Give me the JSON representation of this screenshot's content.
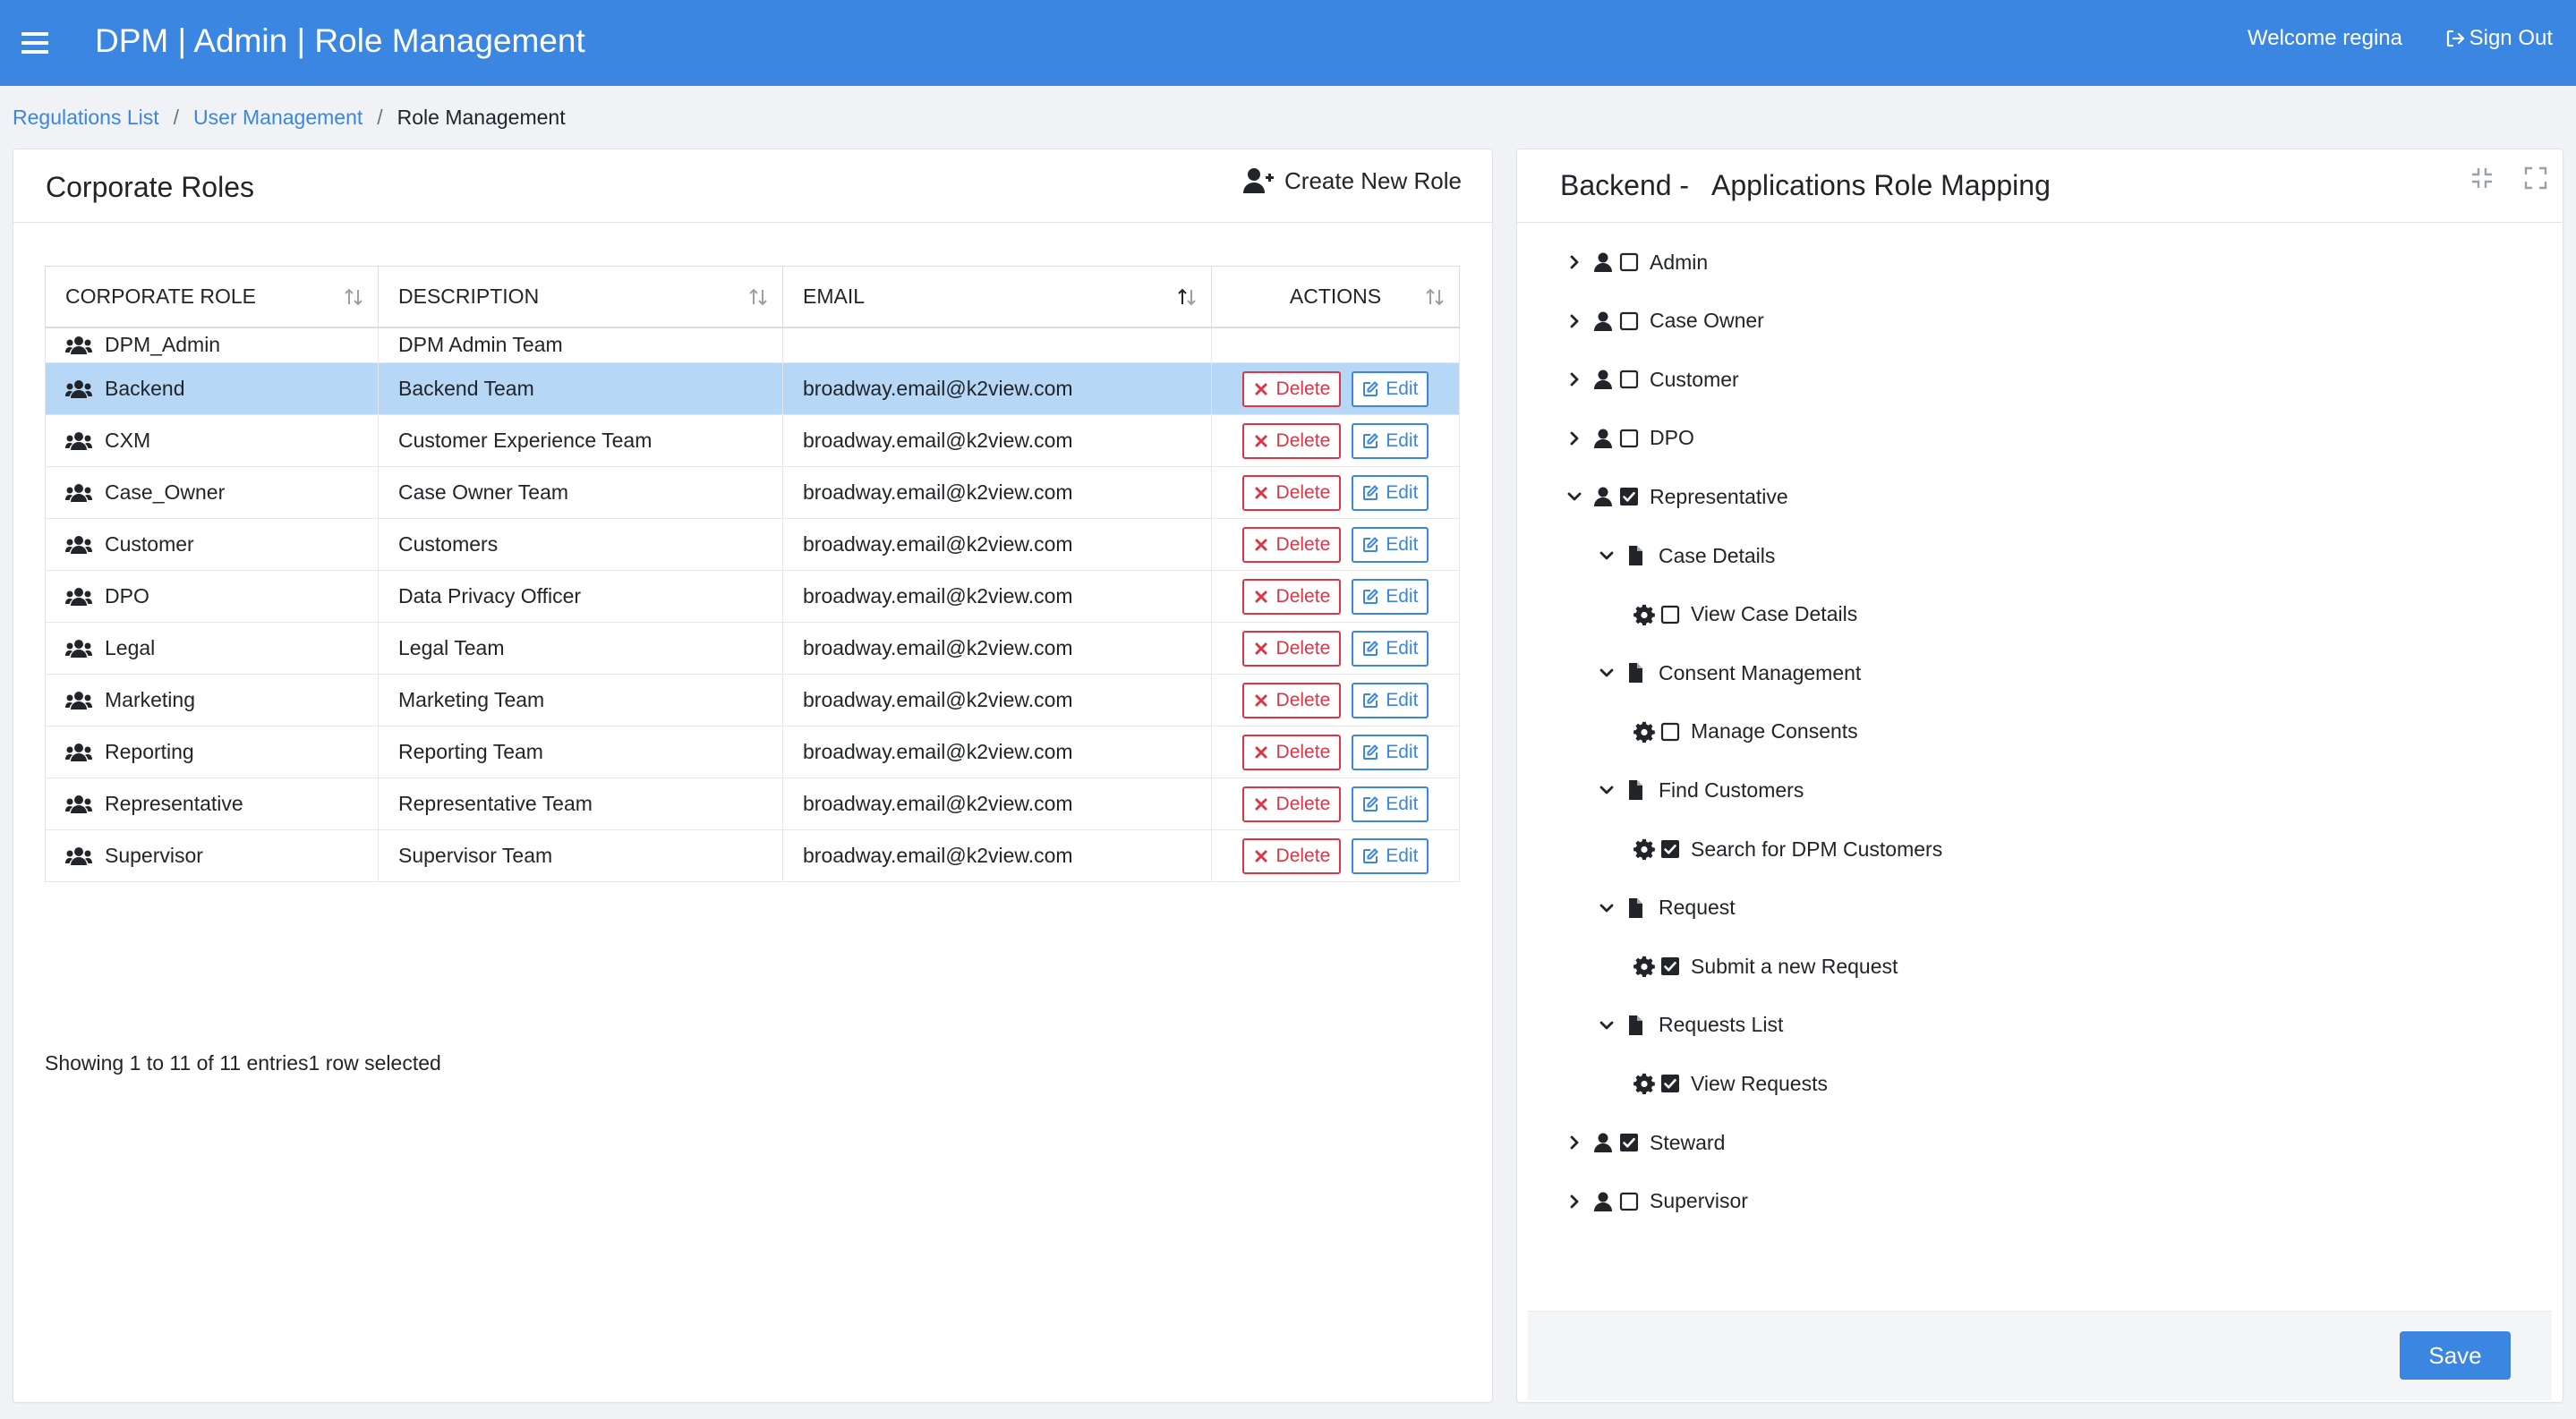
{
  "header": {
    "title": "DPM | Admin | Role Management",
    "welcome": "Welcome regina",
    "signout": "Sign Out"
  },
  "breadcrumb": {
    "items": [
      "Regulations List",
      "User Management"
    ],
    "current": "Role Management",
    "separator": "/"
  },
  "roles_panel": {
    "title": "Corporate Roles",
    "create_label": "Create New Role",
    "columns": [
      "CORPORATE ROLE",
      "DESCRIPTION",
      "EMAIL",
      "ACTIONS"
    ],
    "delete_label": "Delete",
    "edit_label": "Edit",
    "rows": [
      {
        "role": "DPM_Admin",
        "description": "DPM Admin Team",
        "email": ""
      },
      {
        "role": "Backend",
        "description": "Backend Team",
        "email": "broadway.email@k2view.com"
      },
      {
        "role": "CXM",
        "description": "Customer Experience Team",
        "email": "broadway.email@k2view.com"
      },
      {
        "role": "Case_Owner",
        "description": "Case Owner Team",
        "email": "broadway.email@k2view.com"
      },
      {
        "role": "Customer",
        "description": "Customers",
        "email": "broadway.email@k2view.com"
      },
      {
        "role": "DPO",
        "description": "Data Privacy Officer",
        "email": "broadway.email@k2view.com"
      },
      {
        "role": "Legal",
        "description": "Legal Team",
        "email": "broadway.email@k2view.com"
      },
      {
        "role": "Marketing",
        "description": "Marketing Team",
        "email": "broadway.email@k2view.com"
      },
      {
        "role": "Reporting",
        "description": "Reporting Team",
        "email": "broadway.email@k2view.com"
      },
      {
        "role": "Representative",
        "description": "Representative Team",
        "email": "broadway.email@k2view.com"
      },
      {
        "role": "Supervisor",
        "description": "Supervisor Team",
        "email": "broadway.email@k2view.com"
      }
    ],
    "selected_role": "Backend",
    "footer": "Showing 1 to 11 of 11 entries1 row selected"
  },
  "mapping_panel": {
    "title": "Backend -   Applications Role Mapping",
    "save_label": "Save",
    "tree": [
      {
        "label": "Admin",
        "level": 0,
        "type": "user",
        "expanded": false,
        "checked": false
      },
      {
        "label": "Case Owner",
        "level": 0,
        "type": "user",
        "expanded": false,
        "checked": false
      },
      {
        "label": "Customer",
        "level": 0,
        "type": "user",
        "expanded": false,
        "checked": false
      },
      {
        "label": "DPO",
        "level": 0,
        "type": "user",
        "expanded": false,
        "checked": false
      },
      {
        "label": "Representative",
        "level": 0,
        "type": "user",
        "expanded": true,
        "checked": true
      },
      {
        "label": "Case Details",
        "level": 1,
        "type": "file",
        "expanded": true
      },
      {
        "label": "View Case Details",
        "level": 2,
        "type": "gear",
        "checked": false
      },
      {
        "label": "Consent Management",
        "level": 1,
        "type": "file",
        "expanded": true
      },
      {
        "label": "Manage Consents",
        "level": 2,
        "type": "gear",
        "checked": false
      },
      {
        "label": "Find Customers",
        "level": 1,
        "type": "file",
        "expanded": true
      },
      {
        "label": "Search for DPM Customers",
        "level": 2,
        "type": "gear",
        "checked": true
      },
      {
        "label": "Request",
        "level": 1,
        "type": "file",
        "expanded": true
      },
      {
        "label": "Submit a new Request",
        "level": 2,
        "type": "gear",
        "checked": true
      },
      {
        "label": "Requests List",
        "level": 1,
        "type": "file",
        "expanded": true
      },
      {
        "label": "View Requests",
        "level": 2,
        "type": "gear",
        "checked": true
      },
      {
        "label": "Steward",
        "level": 0,
        "type": "user",
        "expanded": false,
        "checked": true
      },
      {
        "label": "Supervisor",
        "level": 0,
        "type": "user",
        "expanded": false,
        "checked": false
      }
    ]
  },
  "colors": {
    "accent": "#3a86e0",
    "danger": "#dc3545",
    "selected_row": "#b7d7f7"
  }
}
